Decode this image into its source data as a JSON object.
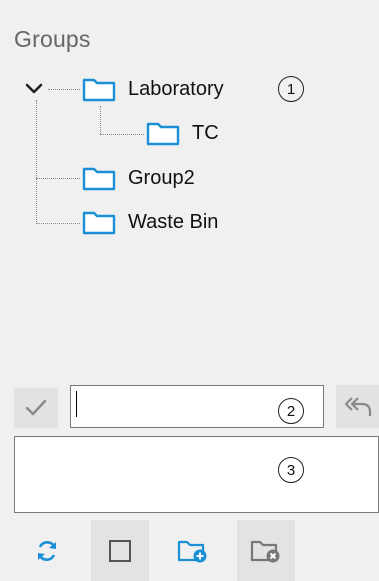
{
  "panel": {
    "title": "Groups"
  },
  "tree": {
    "nodes": [
      {
        "label": "Laboratory",
        "expanded": true
      },
      {
        "label": "TC"
      },
      {
        "label": "Group2"
      },
      {
        "label": "Waste Bin"
      }
    ]
  },
  "callouts": [
    "1",
    "2",
    "3"
  ],
  "edit": {
    "value": ""
  },
  "notes": {
    "value": ""
  },
  "icons": {
    "expander": "chevron-down-icon",
    "folder": "folder-icon",
    "confirm": "checkmark-icon",
    "undo": "undo-arrow-icon",
    "refresh": "refresh-icon",
    "select": "checkbox-icon",
    "add": "add-folder-icon",
    "remove": "remove-folder-icon"
  },
  "colors": {
    "folder_stroke": "#1a8fd6",
    "accent": "#1a8fd6",
    "background": "#f0f0f0"
  }
}
